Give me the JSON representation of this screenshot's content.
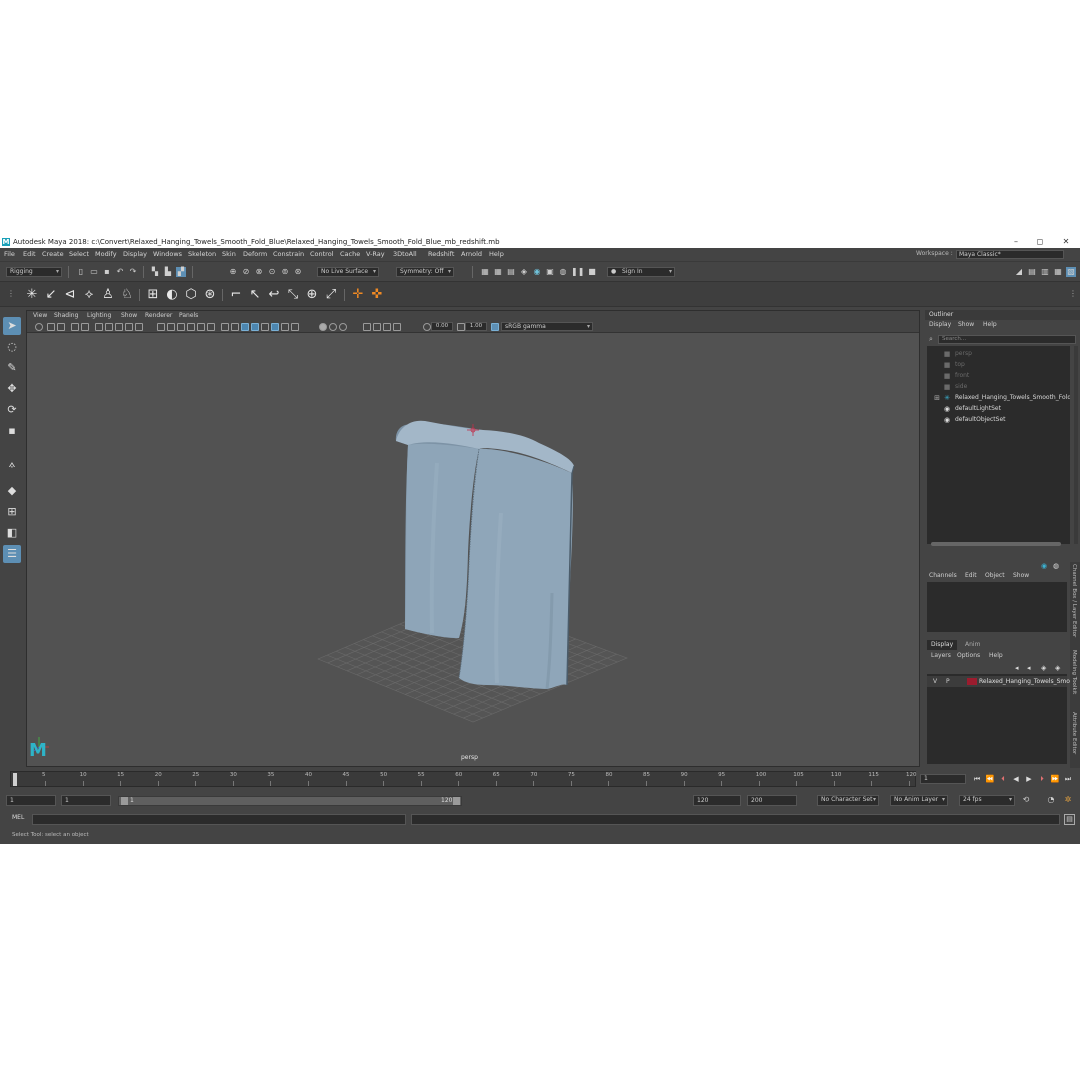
{
  "window": {
    "title": "Autodesk Maya 2018: c:\\Convert\\Relaxed_Hanging_Towels_Smooth_Fold_Blue\\Relaxed_Hanging_Towels_Smooth_Fold_Blue_mb_redshift.mb",
    "logo_letter": "M",
    "minimize": "–",
    "maximize": "◻",
    "close": "✕"
  },
  "menubar": {
    "items": [
      "File",
      "Edit",
      "Create",
      "Select",
      "Modify",
      "Display",
      "Windows",
      "Skeleton",
      "Skin",
      "Deform",
      "Constrain",
      "Control",
      "Cache",
      "V-Ray",
      "3DtoAll",
      "Redshift",
      "Arnold",
      "Help"
    ],
    "workspace_label": "Workspace :",
    "workspace_value": "Maya Classic*"
  },
  "statusline": {
    "menuset": "Rigging",
    "live_surface": "No Live Surface",
    "symmetry": "Symmetry: Off",
    "sign_in": "Sign In"
  },
  "shelf": {
    "icons": [
      "joint-icon",
      "ik-handle-icon",
      "ik-spline-icon",
      "smooth-bind-icon",
      "humanik-icon",
      "character-icon",
      "lattice-icon",
      "cluster-icon",
      "wrap-icon",
      "sculpt-icon",
      "parent-constraint-icon",
      "point-constraint-icon",
      "orient-constraint-icon",
      "scale-constraint-icon",
      "aim-constraint-icon",
      "pole-vector-icon",
      "locator-icon",
      "locator-orange-icon"
    ]
  },
  "viewport": {
    "menus": [
      "View",
      "Shading",
      "Lighting",
      "Show",
      "Renderer",
      "Panels"
    ],
    "exposure": "0.00",
    "gamma": "1.00",
    "color_space": "sRGB gamma",
    "camera_label": "persp",
    "maya_logo": "M"
  },
  "outliner": {
    "title": "Outliner",
    "menus": [
      "Display",
      "Show",
      "Help"
    ],
    "search_placeholder": "Search...",
    "items": [
      {
        "label": "persp",
        "type": "camera",
        "dim": true
      },
      {
        "label": "top",
        "type": "camera",
        "dim": true
      },
      {
        "label": "front",
        "type": "camera",
        "dim": true
      },
      {
        "label": "side",
        "type": "camera",
        "dim": true
      },
      {
        "label": "Relaxed_Hanging_Towels_Smooth_Fold_",
        "type": "group",
        "dim": false
      },
      {
        "label": "defaultLightSet",
        "type": "set",
        "dim": false
      },
      {
        "label": "defaultObjectSet",
        "type": "set",
        "dim": false
      }
    ]
  },
  "channel_box": {
    "menus": [
      "Channels",
      "Edit",
      "Object",
      "Show"
    ]
  },
  "layer_editor": {
    "tabs": [
      "Display",
      "Anim"
    ],
    "menus": [
      "Layers",
      "Options",
      "Help"
    ],
    "layer": {
      "visible": "V",
      "playback": "P",
      "name": "Relaxed_Hanging_Towels_Smo",
      "color": "#9b1c2e"
    }
  },
  "side_tabs": [
    "Channel Box / Layer Editor",
    "Modeling Toolkit",
    "Attribute Editor"
  ],
  "timeline": {
    "ticks": [
      "5",
      "10",
      "15",
      "20",
      "25",
      "30",
      "35",
      "40",
      "45",
      "50",
      "55",
      "60",
      "65",
      "70",
      "75",
      "80",
      "85",
      "90",
      "95",
      "100",
      "105",
      "110",
      "115",
      "120"
    ],
    "current_frame": "1",
    "start": "1",
    "range_start": "1",
    "range_handle_start": "1",
    "range_handle_end": "120",
    "range_end": "120",
    "end": "200",
    "character_set": "No Character Set",
    "anim_layer": "No Anim Layer",
    "fps": "24 fps"
  },
  "command_line": {
    "label": "MEL"
  },
  "help_line": {
    "text": "Select Tool: select an object"
  },
  "colors": {
    "accent": "#5d8fb4",
    "towel": "#8ea5b8",
    "viewport_bg": "#525252"
  }
}
